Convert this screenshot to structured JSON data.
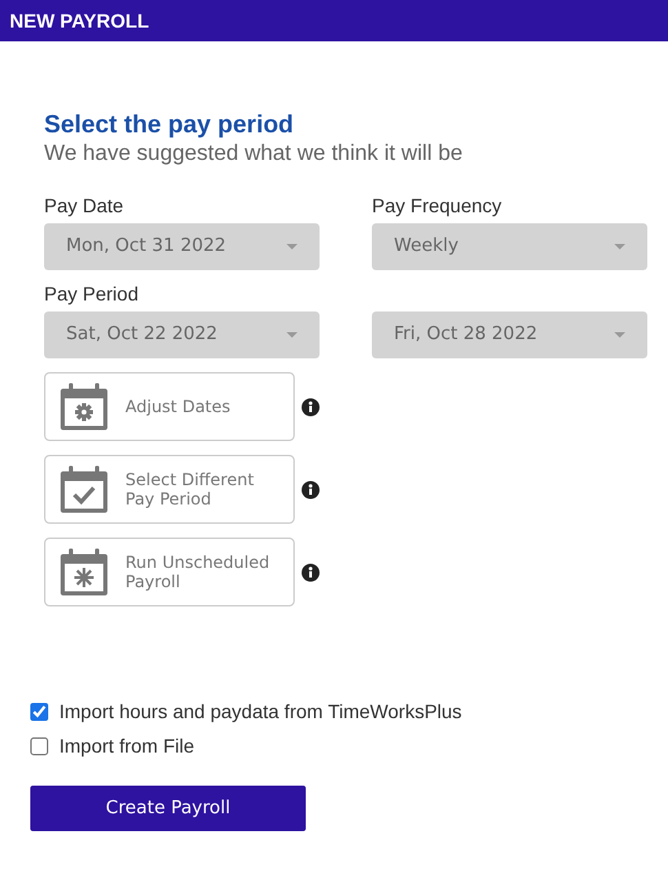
{
  "header": {
    "title": "NEW PAYROLL"
  },
  "heading": "Select the pay period",
  "subheading": "We have suggested what we think it will be",
  "fields": [
    {
      "label": "Pay Date",
      "value": "Mon, Oct 31 2022"
    },
    {
      "label": "Pay Frequency",
      "value": "Weekly"
    },
    {
      "label": "Pay Period",
      "value": "Sat, Oct 22 2022"
    },
    {
      "value": "Fri, Oct 28 2022"
    }
  ],
  "actions": [
    {
      "kind": "gear",
      "label": "Adjust Dates"
    },
    {
      "kind": "check",
      "label": "Select Different Pay Period"
    },
    {
      "kind": "asterisk",
      "label": "Run Unscheduled Payroll"
    }
  ],
  "options": [
    {
      "label": "Import hours and paydata from TimeWorksPlus",
      "checked": true
    },
    {
      "label": "Import from File",
      "checked": false
    }
  ],
  "submit": "Create Payroll"
}
